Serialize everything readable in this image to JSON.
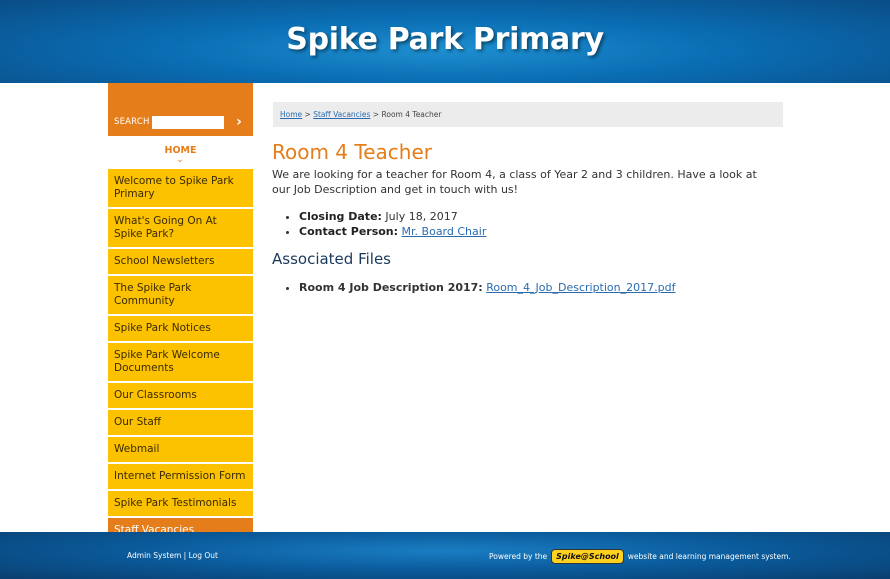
{
  "header": {
    "title": "Spike Park Primary"
  },
  "search": {
    "label": "SEARCH",
    "placeholder": "",
    "go_glyph": "›"
  },
  "home": {
    "label": "HOME",
    "chevron": "⌄"
  },
  "nav": {
    "items": [
      {
        "label": "Welcome to Spike Park Primary"
      },
      {
        "label": "What's Going On At Spike Park?"
      },
      {
        "label": "School Newsletters"
      },
      {
        "label": "The Spike Park Community"
      },
      {
        "label": "Spike Park Notices"
      },
      {
        "label": "Spike Park Welcome Documents"
      },
      {
        "label": "Our Classrooms"
      },
      {
        "label": "Our Staff"
      },
      {
        "label": "Webmail"
      },
      {
        "label": "Internet Permission Form"
      },
      {
        "label": "Spike Park Testimonials"
      },
      {
        "label": "Staff Vacancies"
      }
    ]
  },
  "breadcrumb": {
    "home": "Home",
    "sep1": " > ",
    "parent": "Staff Vacancies",
    "sep2": " > ",
    "current": "Room 4 Teacher"
  },
  "main": {
    "title": "Room 4 Teacher",
    "intro": "We are looking for a teacher for Room 4, a class of Year 2 and 3 children. Have a look at our Job Description and get in touch with us!",
    "closing_label": "Closing Date:",
    "closing_value": " July 18, 2017",
    "contact_label": "Contact Person:",
    "contact_value": "Mr. Board Chair",
    "files_heading": "Associated Files",
    "file_label": "Room 4 Job Description 2017:",
    "file_link": "Room_4_Job_Description_2017.pdf"
  },
  "footer": {
    "admin": "Admin System",
    "sep": " | ",
    "logout": "Log Out",
    "powered_prefix": "Powered by the",
    "logo_text": "Spike@School",
    "powered_suffix": "website and learning management system."
  },
  "colors": {
    "accent": "#e57d1a",
    "nav_bg": "#fcc200",
    "header_blue": "#0a6db3",
    "link": "#2b6cb0"
  }
}
